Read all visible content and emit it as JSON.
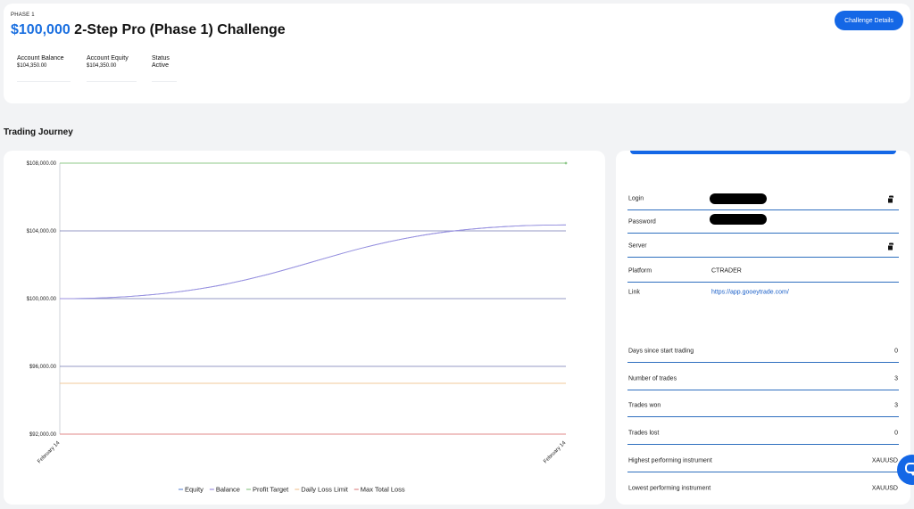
{
  "header": {
    "phase": "PHASE 1",
    "amount": "$100,000",
    "title_rest": " 2-Step Pro (Phase 1) Challenge",
    "details_button": "Challenge Details",
    "stats": [
      {
        "label": "Account Balance",
        "value": "$104,350.00"
      },
      {
        "label": "Account Equity",
        "value": "$104,350.00"
      },
      {
        "label": "Status",
        "value": "Active"
      }
    ]
  },
  "section_title": "Trading Journey",
  "credentials": {
    "login_label": "Login",
    "password_label": "Password",
    "server_label": "Server",
    "platform_label": "Platform",
    "platform_value": "CTRADER",
    "link_label": "Link",
    "link_value": "https://app.gooeytrade.com/"
  },
  "stats": [
    {
      "label": "Days since start trading",
      "value": "0"
    },
    {
      "label": "Number of trades",
      "value": "3"
    },
    {
      "label": "Trades won",
      "value": "3"
    },
    {
      "label": "Trades lost",
      "value": "0"
    },
    {
      "label": "Highest performing instrument",
      "value": "XAUUSD"
    },
    {
      "label": "Lowest performing instrument",
      "value": "XAUUSD"
    }
  ],
  "colors": {
    "accent": "#1467e6",
    "equity": "#6b8fd6",
    "balance": "#9c8fe0",
    "profit_target": "#8fc88a",
    "daily_loss": "#f2c99a",
    "max_loss": "#e08a8a"
  },
  "chart_data": {
    "type": "line",
    "x": [
      "February 14",
      "February 14"
    ],
    "ylim": [
      92000,
      108000
    ],
    "yticks": [
      92000,
      96000,
      100000,
      104000,
      108000
    ],
    "ytick_labels": [
      "$92,000.00",
      "$96,000.00",
      "$100,000.00",
      "$104,000.00",
      "$108,000.00"
    ],
    "series": [
      {
        "name": "Equity",
        "color": "#6b8fd6",
        "values": [
          100000,
          104350
        ]
      },
      {
        "name": "Balance",
        "color": "#9c8fe0",
        "values": [
          100000,
          104350
        ]
      },
      {
        "name": "Profit Target",
        "color": "#8fc88a",
        "values": [
          108000,
          108000
        ]
      },
      {
        "name": "Daily Loss Limit",
        "color": "#f2c99a",
        "values": [
          95000,
          95000
        ]
      },
      {
        "name": "Max Total Loss",
        "color": "#e08a8a",
        "values": [
          92000,
          92000
        ]
      }
    ],
    "legend_position": "bottom",
    "grid": true
  }
}
